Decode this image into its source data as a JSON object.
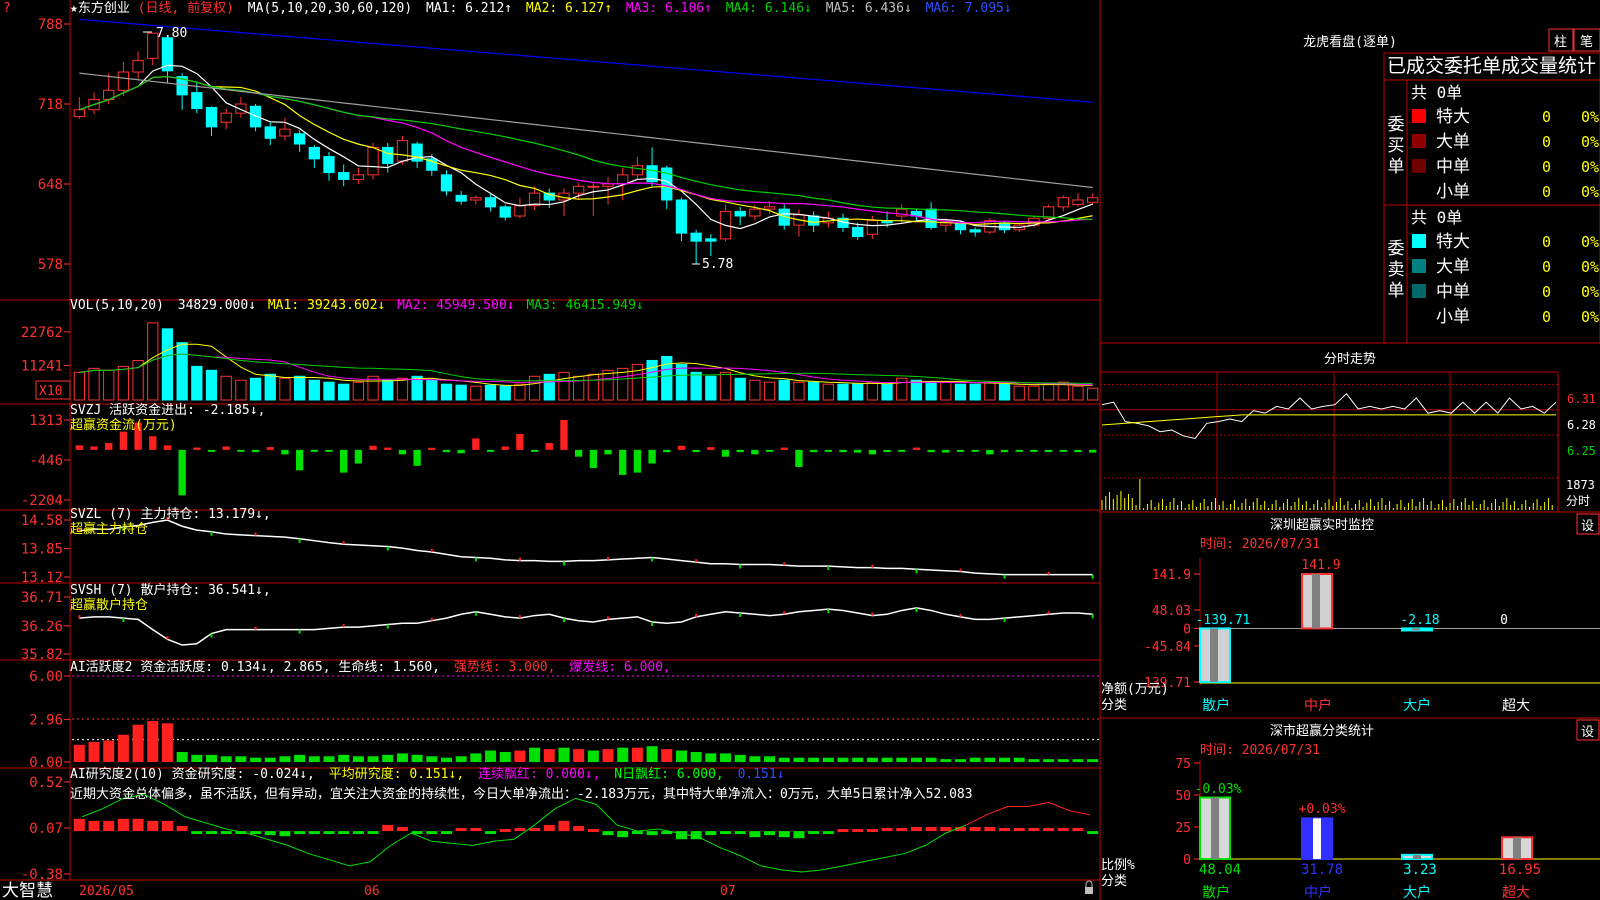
{
  "colors": {
    "up": "#ff3232",
    "down": "#00ffff",
    "green": "#00d000",
    "red_grid": "#b00000",
    "ma1": "#ffffff",
    "ma2": "#ffff00",
    "ma3": "#ff00ff",
    "ma4": "#00d000",
    "ma5": "#a0a0a0",
    "ma6": "#0000ff"
  },
  "app": {
    "brand": "大智慧",
    "corner_mark": "?"
  },
  "kline": {
    "title": "★东方创业",
    "period": "(日线, 前复权)",
    "ma_label": "MA(5,10,20,30,60,120)",
    "ma_items": [
      {
        "label": "MA1: 6.212↑",
        "color": "#ffffff"
      },
      {
        "label": "MA2: 6.127↑",
        "color": "#ffff00"
      },
      {
        "label": "MA3: 6.106↑",
        "color": "#ff00ff"
      },
      {
        "label": "MA4: 6.146↓",
        "color": "#00d000"
      },
      {
        "label": "MA5: 6.436↓",
        "color": "#a0a0a0"
      },
      {
        "label": "MA6: 7.095↓",
        "color": "#0000ff"
      }
    ],
    "yticks": [
      "788",
      "718",
      "648",
      "578"
    ],
    "high_label": "7.80",
    "low_label": "5.78"
  },
  "volume": {
    "label": "VOL(5,10,20)",
    "value": "34829.000↓",
    "ma_items": [
      {
        "label": "MA1: 39243.602↓",
        "color": "#ffff00"
      },
      {
        "label": "MA2: 45949.500↓",
        "color": "#ff00ff"
      },
      {
        "label": "MA3: 46415.949↓",
        "color": "#00d000"
      }
    ],
    "yticks": [
      "22762",
      "11241"
    ],
    "unit_badge": "X10"
  },
  "svzj": {
    "label": "SVZJ  活跃资金进出: -2.185↓,",
    "sub": "超赢资金流(万元)",
    "yticks": [
      "1313",
      "-446",
      "-2204"
    ]
  },
  "svzl": {
    "label": "SVZL (7) 主力持仓: 13.179↓,",
    "sub": "超赢主力持仓",
    "yticks": [
      "14.58",
      "13.85",
      "13.12"
    ]
  },
  "svsh": {
    "label": "SVSH (7) 散户持仓: 36.541↓,",
    "sub": "超赢散户持仓",
    "yticks": [
      "36.71",
      "36.26",
      "35.82"
    ]
  },
  "ai_active": {
    "label": "AI活跃度2 资金活跃度: 0.134↓, 2.865, 生命线: 1.560,",
    "strong": "强势线: 3.000,",
    "burst": "爆发线: 6.000,",
    "yticks": [
      "6.00",
      "2.96",
      "0.00"
    ]
  },
  "ai_research": {
    "label": "AI研究度2(10) 资金研究度: -0.024↓,",
    "avg": "平均研究度: 0.151↓,",
    "red_series": "连续飘红: 0.000↓,",
    "n_red": "N日飘红: 6.000,",
    "last": "0.151↓",
    "comment": "近期大资金总体偏多，虽不活跃，但有异动，宜关注大资金的持续性，今日大单净流出：-2.183万元，其中特大单净流入：0万元，大单5日累计净入52.083",
    "yticks": [
      "0.52",
      "0.07",
      "-0.38"
    ]
  },
  "xaxis": {
    "labels": [
      "2026/05",
      "06",
      "07"
    ]
  },
  "lhkp": {
    "title": "龙虎看盘(逐单)",
    "btn1": "柱",
    "btn2": "笔",
    "subtitle": "已成交委托单成交量统计",
    "buy_label": "委买单",
    "sell_label": "委卖单",
    "buy_total": "共 0单",
    "sell_total": "共 0单",
    "buy_rows": [
      {
        "name": "特大",
        "count": "0",
        "pct": "0%",
        "color": "#ff0000"
      },
      {
        "name": "大单",
        "count": "0",
        "pct": "0%",
        "color": "#900000"
      },
      {
        "name": "中单",
        "count": "0",
        "pct": "0%",
        "color": "#700000"
      },
      {
        "name": "小单",
        "count": "0",
        "pct": "0%",
        "color": "#000000"
      }
    ],
    "sell_rows": [
      {
        "name": "特大",
        "count": "0",
        "pct": "0%",
        "color": "#00ffff"
      },
      {
        "name": "大单",
        "count": "0",
        "pct": "0%",
        "color": "#008080"
      },
      {
        "name": "中单",
        "count": "0",
        "pct": "0%",
        "color": "#006868"
      },
      {
        "name": "小单",
        "count": "0",
        "pct": "0%",
        "color": "#000000"
      }
    ]
  },
  "fenshi": {
    "title": "分时走势",
    "yticks": [
      "6.31",
      "6.28",
      "6.25"
    ],
    "vol_top": "1873",
    "vol_unit": "分时"
  },
  "sz_monitor": {
    "title": "深圳超赢实时监控",
    "setting": "设",
    "time": "时间: 2026/07/31",
    "yticks": [
      "141.9",
      "48.03",
      "0",
      "-45.84",
      "-139.71"
    ],
    "ylabel": "净额(万元)",
    "xlabel": "分类",
    "categories": [
      "散户",
      "中户",
      "大户",
      "超大"
    ],
    "value_labels": [
      "-139.71",
      "141.9",
      "-2.18",
      "0"
    ]
  },
  "sz_class": {
    "title": "深市超赢分类统计",
    "setting": "设",
    "time": "时间: 2026/07/31",
    "yticks": [
      "75",
      "50",
      "25",
      "0"
    ],
    "ylabel": "比例%",
    "xlabel": "分类",
    "categories": [
      "散户",
      "中户",
      "大户",
      "超大"
    ],
    "change_labels": [
      "-0.03%",
      "+0.03%"
    ],
    "value_labels": [
      "48.04",
      "31.78",
      "3.23",
      "16.95"
    ]
  },
  "chart_data": [
    {
      "type": "candlestick",
      "title": "东方创业 (日线, 前复权)",
      "candles": [
        [
          7.07,
          7.13,
          7.24,
          7.05
        ],
        [
          7.13,
          7.22,
          7.28,
          7.09
        ],
        [
          7.22,
          7.3,
          7.45,
          7.18
        ],
        [
          7.3,
          7.46,
          7.55,
          7.25
        ],
        [
          7.46,
          7.56,
          7.64,
          7.4
        ],
        [
          7.58,
          7.8,
          7.8,
          7.52
        ],
        [
          7.76,
          7.47,
          7.78,
          7.36
        ],
        [
          7.42,
          7.26,
          7.45,
          7.13
        ],
        [
          7.28,
          7.14,
          7.38,
          7.1
        ],
        [
          7.15,
          6.98,
          7.16,
          6.9
        ],
        [
          7.02,
          7.1,
          7.14,
          6.96
        ],
        [
          7.1,
          7.18,
          7.24,
          7.06
        ],
        [
          7.16,
          6.98,
          7.18,
          6.94
        ],
        [
          6.98,
          6.88,
          7.02,
          6.82
        ],
        [
          6.9,
          6.96,
          7.06,
          6.86
        ],
        [
          6.92,
          6.83,
          6.95,
          6.76
        ],
        [
          6.8,
          6.7,
          6.82,
          6.62
        ],
        [
          6.72,
          6.58,
          6.76,
          6.51
        ],
        [
          6.58,
          6.52,
          6.65,
          6.46
        ],
        [
          6.52,
          6.56,
          6.62,
          6.48
        ],
        [
          6.56,
          6.8,
          6.84,
          6.52
        ],
        [
          6.8,
          6.66,
          6.84,
          6.58
        ],
        [
          6.68,
          6.86,
          6.9,
          6.65
        ],
        [
          6.83,
          6.68,
          6.85,
          6.62
        ],
        [
          6.7,
          6.6,
          6.74,
          6.55
        ],
        [
          6.56,
          6.42,
          6.6,
          6.38
        ],
        [
          6.38,
          6.33,
          6.42,
          6.3
        ],
        [
          6.34,
          6.36,
          6.38,
          6.3
        ],
        [
          6.36,
          6.28,
          6.39,
          6.24
        ],
        [
          6.28,
          6.19,
          6.3,
          6.16
        ],
        [
          6.2,
          6.29,
          6.36,
          6.18
        ],
        [
          6.29,
          6.4,
          6.46,
          6.25
        ],
        [
          6.4,
          6.34,
          6.44,
          6.27
        ],
        [
          6.34,
          6.4,
          6.44,
          6.2
        ],
        [
          6.4,
          6.46,
          6.49,
          6.35
        ],
        [
          6.46,
          6.46,
          6.5,
          6.2
        ],
        [
          6.46,
          6.48,
          6.54,
          6.3
        ],
        [
          6.48,
          6.56,
          6.62,
          6.34
        ],
        [
          6.56,
          6.64,
          6.72,
          6.52
        ],
        [
          6.64,
          6.5,
          6.8,
          6.46
        ],
        [
          6.62,
          6.34,
          6.64,
          6.26
        ],
        [
          6.34,
          6.05,
          6.36,
          5.98
        ],
        [
          6.05,
          5.98,
          6.08,
          5.78
        ],
        [
          6.0,
          5.98,
          6.04,
          5.85
        ],
        [
          6.0,
          6.24,
          6.3,
          5.98
        ],
        [
          6.24,
          6.2,
          6.28,
          6.12
        ],
        [
          6.2,
          6.26,
          6.3,
          6.16
        ],
        [
          6.26,
          6.28,
          6.33,
          6.22
        ],
        [
          6.26,
          6.12,
          6.3,
          6.08
        ],
        [
          6.12,
          6.21,
          6.26,
          6.02
        ],
        [
          6.2,
          6.12,
          6.24,
          6.06
        ],
        [
          6.14,
          6.18,
          6.24,
          6.1
        ],
        [
          6.18,
          6.1,
          6.22,
          6.06
        ],
        [
          6.1,
          6.02,
          6.14,
          5.99
        ],
        [
          6.04,
          6.16,
          6.2,
          6.0
        ],
        [
          6.16,
          6.14,
          6.24,
          6.1
        ],
        [
          6.2,
          6.26,
          6.3,
          6.14
        ],
        [
          6.24,
          6.2,
          6.26,
          6.16
        ],
        [
          6.26,
          6.1,
          6.32,
          6.08
        ],
        [
          6.12,
          6.14,
          6.18,
          6.06
        ],
        [
          6.14,
          6.08,
          6.16,
          6.04
        ],
        [
          6.08,
          6.06,
          6.1,
          6.02
        ],
        [
          6.06,
          6.16,
          6.18,
          6.04
        ],
        [
          6.14,
          6.08,
          6.16,
          6.05
        ],
        [
          6.08,
          6.12,
          6.14,
          6.06
        ],
        [
          6.12,
          6.18,
          6.2,
          6.1
        ],
        [
          6.18,
          6.28,
          6.3,
          6.16
        ],
        [
          6.28,
          6.36,
          6.38,
          6.24
        ],
        [
          6.3,
          6.34,
          6.4,
          6.28
        ],
        [
          6.32,
          6.36,
          6.4,
          6.3
        ]
      ],
      "ylim": [
        5.5,
        7.95
      ]
    },
    {
      "type": "bar",
      "title": "VOL(5,10,20)",
      "values": [
        28,
        32,
        30,
        34,
        40,
        78,
        72,
        58,
        34,
        30,
        24,
        20,
        22,
        26,
        22,
        24,
        20,
        18,
        16,
        18,
        24,
        20,
        22,
        24,
        20,
        16,
        15,
        14,
        15,
        14,
        16,
        24,
        26,
        28,
        24,
        26,
        30,
        32,
        36,
        40,
        44,
        36,
        28,
        24,
        28,
        22,
        20,
        18,
        20,
        18,
        18,
        16,
        16,
        16,
        18,
        16,
        22,
        20,
        18,
        18,
        16,
        16,
        18,
        16,
        14,
        14,
        16,
        18,
        14,
        12
      ],
      "ylim": [
        0,
        85
      ]
    },
    {
      "type": "bar",
      "title": "超赢资金流(万元)",
      "values": [
        200,
        150,
        300,
        800,
        1200,
        600,
        200,
        -2000,
        100,
        -80,
        150,
        -60,
        -100,
        120,
        -200,
        -900,
        -60,
        -80,
        -1000,
        -600,
        180,
        100,
        -200,
        -700,
        90,
        -100,
        -150,
        500,
        -50,
        150,
        700,
        -80,
        300,
        1313,
        -300,
        -800,
        -200,
        -1100,
        -1000,
        -600,
        -100,
        180,
        -100,
        120,
        -300,
        -100,
        -200,
        -80,
        100,
        -750,
        -100,
        -80,
        -100,
        -120,
        -200,
        -100,
        -80,
        100,
        -100,
        -120,
        -90,
        -80,
        -200,
        -100,
        -50,
        -90,
        -100,
        -80,
        -100,
        -120
      ],
      "ylim": [
        -2204,
        1313
      ]
    },
    {
      "type": "line",
      "title": "超赢主力持仓",
      "values": [
        14.3,
        14.35,
        14.34,
        14.4,
        14.44,
        14.52,
        14.58,
        14.42,
        14.32,
        14.28,
        14.22,
        14.2,
        14.18,
        14.16,
        14.14,
        14.1,
        14.05,
        14.0,
        13.96,
        13.94,
        13.92,
        13.9,
        13.86,
        13.8,
        13.76,
        13.7,
        13.64,
        13.62,
        13.6,
        13.56,
        13.54,
        13.54,
        13.52,
        13.52,
        13.54,
        13.54,
        13.56,
        13.58,
        13.6,
        13.62,
        13.58,
        13.54,
        13.5,
        13.46,
        13.46,
        13.44,
        13.44,
        13.44,
        13.42,
        13.4,
        13.4,
        13.4,
        13.38,
        13.36,
        13.36,
        13.34,
        13.34,
        13.32,
        13.3,
        13.28,
        13.26,
        13.22,
        13.2,
        13.18,
        13.18,
        13.18,
        13.18,
        13.18,
        13.18,
        13.18
      ],
      "ylim": [
        13.12,
        14.58
      ]
    },
    {
      "type": "line",
      "title": "超赢散户持仓",
      "values": [
        36.38,
        36.4,
        36.4,
        36.38,
        36.36,
        36.2,
        36.05,
        35.96,
        35.98,
        36.14,
        36.2,
        36.2,
        36.2,
        36.2,
        36.2,
        36.2,
        36.2,
        36.22,
        36.24,
        36.24,
        36.26,
        36.28,
        36.3,
        36.3,
        36.34,
        36.38,
        36.44,
        36.48,
        36.44,
        36.4,
        36.38,
        36.42,
        36.44,
        36.38,
        36.34,
        36.32,
        36.36,
        36.38,
        36.4,
        36.32,
        36.3,
        36.32,
        36.4,
        36.44,
        36.48,
        36.46,
        36.44,
        36.42,
        36.44,
        36.48,
        36.5,
        36.52,
        36.5,
        36.46,
        36.42,
        36.44,
        36.5,
        36.54,
        36.5,
        36.44,
        36.4,
        36.36,
        36.36,
        36.38,
        36.4,
        36.42,
        36.44,
        36.46,
        36.46,
        36.44
      ],
      "ylim": [
        35.82,
        36.71
      ]
    },
    {
      "type": "bar",
      "title": "AI活跃度2",
      "values": [
        1.2,
        1.4,
        1.5,
        1.9,
        2.6,
        2.86,
        2.7,
        0.7,
        0.5,
        0.5,
        0.4,
        0.4,
        0.3,
        0.3,
        0.4,
        0.5,
        0.4,
        0.4,
        0.5,
        0.4,
        0.4,
        0.5,
        0.6,
        0.5,
        0.4,
        0.3,
        0.4,
        0.6,
        0.8,
        0.7,
        0.8,
        1.0,
        0.9,
        1.0,
        0.9,
        0.8,
        0.9,
        1.0,
        1.0,
        1.1,
        0.9,
        0.8,
        0.7,
        0.6,
        0.6,
        0.5,
        0.4,
        0.4,
        0.3,
        0.3,
        0.3,
        0.3,
        0.3,
        0.3,
        0.3,
        0.3,
        0.3,
        0.3,
        0.3,
        0.2,
        0.2,
        0.3,
        0.3,
        0.3,
        0.3,
        0.2,
        0.2,
        0.2,
        0.2,
        0.2
      ],
      "ylim": [
        0,
        6.0
      ]
    },
    {
      "type": "bar",
      "title": "AI研究度2(10)",
      "values": [
        0.12,
        0.1,
        0.1,
        0.12,
        0.12,
        0.1,
        0.1,
        0.05,
        -0.01,
        -0.01,
        -0.01,
        -0.01,
        -0.02,
        -0.04,
        -0.05,
        -0.03,
        -0.03,
        -0.01,
        -0.01,
        -0.01,
        -0.01,
        0.06,
        0.04,
        -0.02,
        -0.03,
        -0.02,
        0.03,
        0.03,
        -0.01,
        0.02,
        0.03,
        0.03,
        0.06,
        0.1,
        0.05,
        0.02,
        -0.04,
        -0.06,
        -0.02,
        -0.04,
        -0.02,
        -0.08,
        -0.08,
        -0.04,
        -0.02,
        -0.03,
        -0.06,
        -0.04,
        -0.06,
        -0.07,
        -0.02,
        -0.01,
        0.02,
        0.02,
        0.02,
        0.03,
        0.03,
        0.04,
        0.04,
        0.04,
        0.04,
        0.04,
        0.04,
        0.03,
        0.03,
        0.03,
        0.03,
        0.03,
        0.03,
        -0.02
      ],
      "line": [
        0.18,
        0.26,
        0.36,
        0.4,
        0.3,
        0.18,
        0.12,
        0.06,
        0.02,
        -0.04,
        -0.1,
        -0.18,
        -0.24,
        -0.3,
        -0.26,
        -0.1,
        0.02,
        -0.06,
        -0.08,
        -0.1,
        -0.06,
        -0.04,
        0.1,
        0.26,
        0.36,
        0.3,
        0.1,
        0.04,
        0.06,
        0.02,
        -0.02,
        -0.12,
        -0.2,
        -0.3,
        -0.34,
        -0.36,
        -0.34,
        -0.3,
        -0.26,
        -0.22,
        -0.18,
        -0.1,
        0.02,
        0.1,
        0.2,
        0.28,
        0.28,
        0.32,
        0.24,
        0.2
      ],
      "ylim": [
        -0.38,
        0.52
      ]
    },
    {
      "type": "line",
      "title": "分时走势",
      "values": [
        6.29,
        6.285,
        6.27,
        6.26,
        6.265,
        6.25,
        6.26,
        6.245,
        6.25,
        6.26,
        6.27,
        6.265,
        6.27,
        6.275,
        6.28,
        6.28,
        6.285,
        6.29,
        6.285,
        6.28,
        6.29,
        6.295,
        6.285,
        6.28,
        6.285,
        6.28,
        6.285,
        6.29,
        6.28,
        6.275,
        6.28,
        6.285,
        6.28,
        6.285,
        6.28,
        6.29,
        6.285,
        6.28,
        6.28,
        6.285
      ],
      "ylim": [
        6.23,
        6.32
      ]
    },
    {
      "type": "bar",
      "title": "深圳超赢实时监控",
      "categories": [
        "散户",
        "中户",
        "大户",
        "超大"
      ],
      "values": [
        -139.71,
        141.9,
        -2.18,
        0
      ],
      "ylim": [
        -139.71,
        141.9
      ]
    },
    {
      "type": "bar",
      "title": "深市超赢分类统计",
      "categories": [
        "散户",
        "中户",
        "大户",
        "超大"
      ],
      "values": [
        48.04,
        31.78,
        3.23,
        16.95
      ],
      "ylim": [
        0,
        75
      ]
    }
  ]
}
